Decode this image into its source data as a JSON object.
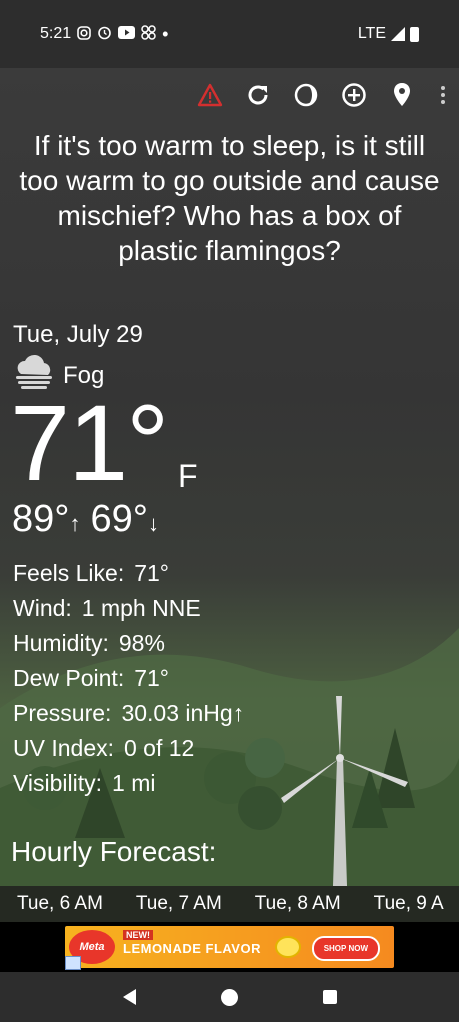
{
  "status_bar": {
    "time": "5:21",
    "icons": [
      "instagram-icon",
      "alarm-icon",
      "youtube-icon",
      "pinwheel-icon",
      "dot-icon"
    ],
    "network": "LTE"
  },
  "toolbar": {
    "icons": [
      "alert-icon",
      "refresh-icon",
      "moon-phase-icon",
      "add-icon",
      "location-pin-icon",
      "more-vert-icon"
    ],
    "alert_color": "#d32f2f"
  },
  "message": "If it's too warm to sleep, is it still too warm to go outside and cause mischief? Who has a box of plastic flamingos?",
  "weather": {
    "date": "Tue, July 29",
    "condition": "Fog",
    "condition_icon": "fog-cloud-icon",
    "temperature": "71°",
    "unit": "F",
    "high": "89°",
    "low": "69°"
  },
  "details": [
    {
      "label": "Feels Like:",
      "value": "71°"
    },
    {
      "label": "Wind:",
      "value": "1 mph NNE"
    },
    {
      "label": "Humidity:",
      "value": "98%"
    },
    {
      "label": "Dew Point:",
      "value": "71°"
    },
    {
      "label": "Pressure:",
      "value": "30.03 inHg↑"
    },
    {
      "label": "UV Index:",
      "value": "0 of 12"
    },
    {
      "label": "Visibility:",
      "value": "1 mi"
    }
  ],
  "hourly": {
    "title": "Hourly Forecast:",
    "times": [
      "Tue, 6 AM",
      "Tue, 7 AM",
      "Tue, 8 AM",
      "Tue, 9 A"
    ]
  },
  "ad": {
    "logo": "Meta",
    "new_tag": "NEW!",
    "title": "LEMONADE FLAVOR",
    "cta": "SHOP NOW"
  }
}
